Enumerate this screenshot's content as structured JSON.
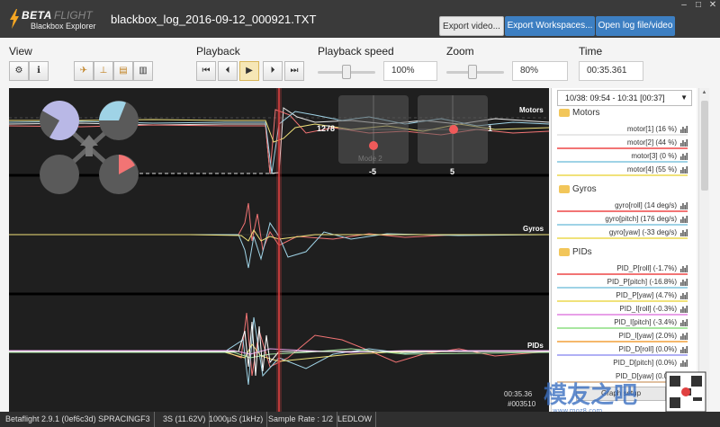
{
  "titlebar": {
    "logo_beta": "BETA",
    "logo_flight": "FLIGHT",
    "logo_sub": "Blackbox Explorer",
    "filename": "blackbox_log_2016-09-12_000921.TXT",
    "export_video": "Export video...",
    "export_workspaces": "Export Workspaces...",
    "open_log": "Open log file/video"
  },
  "toolbar": {
    "view_label": "View",
    "playback_label": "Playback",
    "speed_label": "Playback speed",
    "zoom_label": "Zoom",
    "time_label": "Time",
    "speed_value": "100%",
    "zoom_value": "80%",
    "time_value": "00:35.361",
    "speed_level": 0.5,
    "zoom_level": 0.45
  },
  "graph": {
    "labels": {
      "motors": "Motors",
      "gyros": "Gyros",
      "pids": "PIDs"
    },
    "stick_left_mode": "Mode 2",
    "stick_left_top_value": "1278",
    "stick_left_bottom_value": "-5",
    "stick_right_side_value": "1",
    "stick_right_bottom_value": "5",
    "time_overlay": "00:35.36",
    "frame_overlay": "#003510"
  },
  "legend": {
    "workspace": "10/38: 09:54 - 10:31 [00:37]",
    "groups": [
      {
        "name": "Motors",
        "items": [
          {
            "label": "motor[1] (16 %)",
            "color": "#e8e8e8"
          },
          {
            "label": "motor[2] (44 %)",
            "color": "#f27474"
          },
          {
            "label": "motor[3] (0 %)",
            "color": "#9fd3e6"
          },
          {
            "label": "motor[4] (55 %)",
            "color": "#f0e27a"
          }
        ]
      },
      {
        "name": "Gyros",
        "items": [
          {
            "label": "gyro[roll] (14 deg/s)",
            "color": "#f27474"
          },
          {
            "label": "gyro[pitch] (176 deg/s)",
            "color": "#9fd3e6"
          },
          {
            "label": "gyro[yaw] (-33 deg/s)",
            "color": "#f0e27a"
          }
        ]
      },
      {
        "name": "PIDs",
        "items": [
          {
            "label": "PID_P[roll] (-1.7%)",
            "color": "#f27474"
          },
          {
            "label": "PID_P[pitch] (-16.8%)",
            "color": "#9fd3e6"
          },
          {
            "label": "PID_P[yaw] (4.7%)",
            "color": "#f0e27a"
          },
          {
            "label": "PID_I[roll] (-0.3%)",
            "color": "#e8a0e8"
          },
          {
            "label": "PID_I[pitch] (-3.4%)",
            "color": "#a8e6a0"
          },
          {
            "label": "PID_I[yaw] (2.0%)",
            "color": "#f5b86b"
          },
          {
            "label": "PID_D[roll] (0.0%)",
            "color": "#b0b0f5"
          },
          {
            "label": "PID_D[pitch] (0.0%)",
            "color": "#ffffff"
          },
          {
            "label": "PID_D[yaw] (0.0%)",
            "color": "#e0c0a0"
          }
        ]
      }
    ],
    "graph_setup": "Graph setup"
  },
  "statusbar": {
    "firmware": "Betaflight 2.9.1 (0ef6c3d) SPRACINGF3",
    "battery": "3S (11.62V)",
    "looptime": "1000μS (1kHz)",
    "sample_rate": "Sample Rate : 1/2",
    "debug": "LEDLOW"
  },
  "watermark": {
    "text": "模友之吧",
    "url": "www.moz8.com"
  },
  "colors": {
    "accent": "#3d7fc2",
    "cursor": "#e04040",
    "graph_bg": "#1f1f1f"
  }
}
